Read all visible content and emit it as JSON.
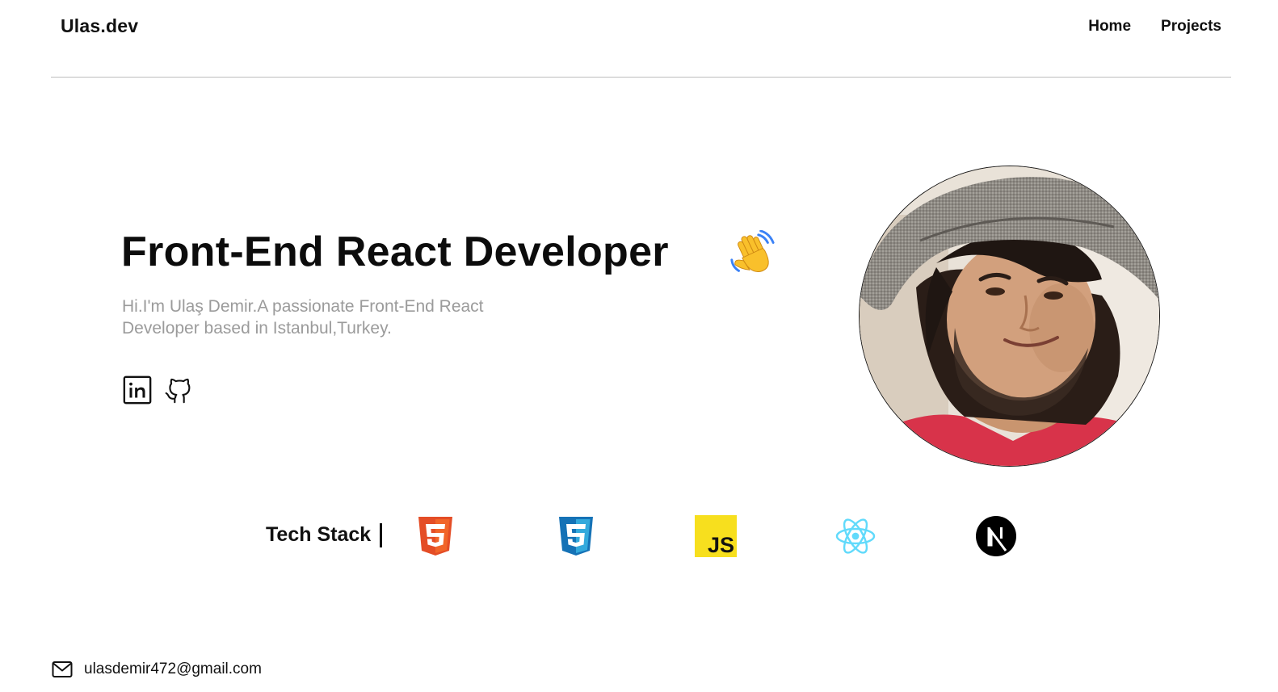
{
  "header": {
    "brand": "Ulas.dev",
    "nav": [
      {
        "label": "Home"
      },
      {
        "label": "Projects"
      }
    ]
  },
  "hero": {
    "title": "Front-End React Developer",
    "wave_icon": "waving-hand-icon",
    "description": "Hi.I'm Ulaş Demir.A passionate Front-End React Developer based in Istanbul,Turkey.",
    "social": [
      {
        "icon": "linkedin-icon"
      },
      {
        "icon": "github-icon"
      }
    ],
    "avatar": "profile-photo"
  },
  "tech_stack": {
    "label": "Tech Stack",
    "items": [
      {
        "icon": "html5-icon",
        "color": "#E44D26"
      },
      {
        "icon": "css3-icon",
        "color": "#1572B6"
      },
      {
        "icon": "javascript-icon",
        "color": "#F7DF1E"
      },
      {
        "icon": "react-icon",
        "color": "#61DAFB"
      },
      {
        "icon": "nextjs-icon",
        "color": "#000000"
      }
    ]
  },
  "footer": {
    "email_icon": "mail-icon",
    "email": "ulasdemir472@gmail.com"
  }
}
